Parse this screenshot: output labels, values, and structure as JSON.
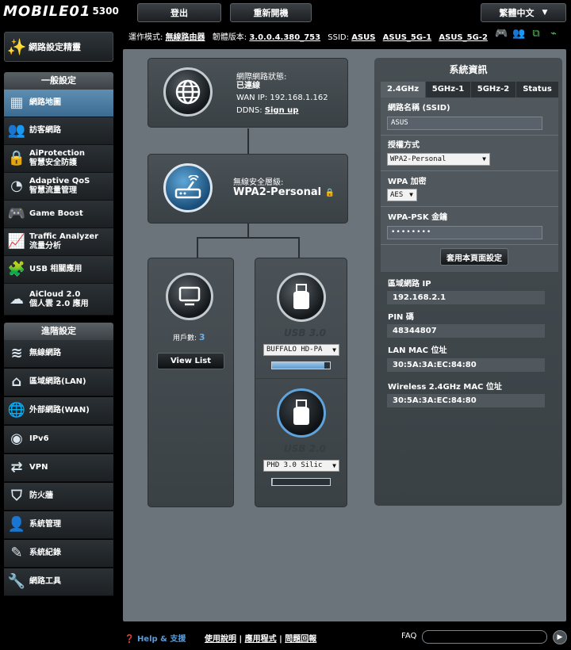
{
  "header": {
    "logo": "MOBILE01",
    "model": "5300",
    "logout": "登出",
    "reboot": "重新開機",
    "language": "繁體中文"
  },
  "status": {
    "mode_label": "運作模式:",
    "mode": "無線路由器",
    "firmware_label": "韌體版本:",
    "firmware": "3.0.0.4.380_753",
    "ssid_label": "SSID:",
    "ssids": [
      "ASUS",
      "ASUS_5G-1",
      "ASUS_5G-2"
    ]
  },
  "menu": {
    "wizard": "網路設定精靈",
    "general_title": "一般設定",
    "general": [
      {
        "label": "網路地圖",
        "icon": "network-map-icon"
      },
      {
        "label": "訪客網路",
        "icon": "guest-network-icon"
      },
      {
        "label": "AiProtection",
        "label2": "智慧安全防護",
        "icon": "lock-icon"
      },
      {
        "label": "Adaptive QoS",
        "label2": "智慧流量管理",
        "icon": "speedometer-icon"
      },
      {
        "label": "Game Boost",
        "icon": "gamepad-icon"
      },
      {
        "label": "Traffic Analyzer",
        "label2": "流量分析",
        "icon": "chart-icon"
      },
      {
        "label": "USB 相關應用",
        "icon": "puzzle-icon"
      },
      {
        "label": "AiCloud 2.0",
        "label2": "個人雲 2.0 應用",
        "icon": "cloud-icon"
      }
    ],
    "advanced_title": "進階設定",
    "advanced": [
      {
        "label": "無線網路",
        "icon": "wifi-icon"
      },
      {
        "label": "區域網路(LAN)",
        "icon": "home-icon"
      },
      {
        "label": "外部網路(WAN)",
        "icon": "globe-icon"
      },
      {
        "label": "IPv6",
        "icon": "ipv6-icon"
      },
      {
        "label": "VPN",
        "icon": "vpn-icon"
      },
      {
        "label": "防火牆",
        "icon": "shield-icon"
      },
      {
        "label": "系統管理",
        "icon": "admin-icon"
      },
      {
        "label": "系統紀錄",
        "icon": "log-icon"
      },
      {
        "label": "網路工具",
        "icon": "tools-icon"
      }
    ]
  },
  "internet": {
    "status_label": "網際網路狀態:",
    "status": "已連線",
    "wan_ip_label": "WAN IP:",
    "wan_ip": "192.168.1.162",
    "ddns_label": "DDNS:",
    "ddns": "Sign up"
  },
  "wireless": {
    "security_label": "無線安全層級:",
    "security": "WPA2-Personal"
  },
  "clients": {
    "count_label": "用戶數:",
    "count": "3",
    "view_list": "View List"
  },
  "usb": [
    {
      "label": "USB 3.0",
      "device": "BUFFALO HD-PA",
      "usage": 0.9
    },
    {
      "label": "USB 2.0",
      "device": "PHD 3.0 Silic",
      "usage": 0.02
    }
  ],
  "sysinfo": {
    "title": "系統資訊",
    "tabs": [
      "2.4GHz",
      "5GHz-1",
      "5GHz-2",
      "Status"
    ],
    "ssid_label": "網路名稱 (SSID)",
    "ssid": "ASUS",
    "auth_label": "授權方式",
    "auth": "WPA2-Personal",
    "wpa_label": "WPA 加密",
    "wpa": "AES",
    "psk_label": "WPA-PSK 金鑰",
    "psk": "••••••••",
    "apply": "套用本頁面設定",
    "lan_ip_label": "區域網路 IP",
    "lan_ip": "192.168.2.1",
    "pin_label": "PIN 碼",
    "pin": "48344807",
    "lan_mac_label": "LAN MAC 位址",
    "lan_mac": "30:5A:3A:EC:84:80",
    "wl_mac_label": "Wireless 2.4GHz MAC 位址",
    "wl_mac": "30:5A:3A:EC:84:80"
  },
  "footer": {
    "help": "Help & 支援",
    "manual": "使用說明",
    "utility": "應用程式",
    "feedback": "問題回報",
    "faq": "FAQ"
  }
}
